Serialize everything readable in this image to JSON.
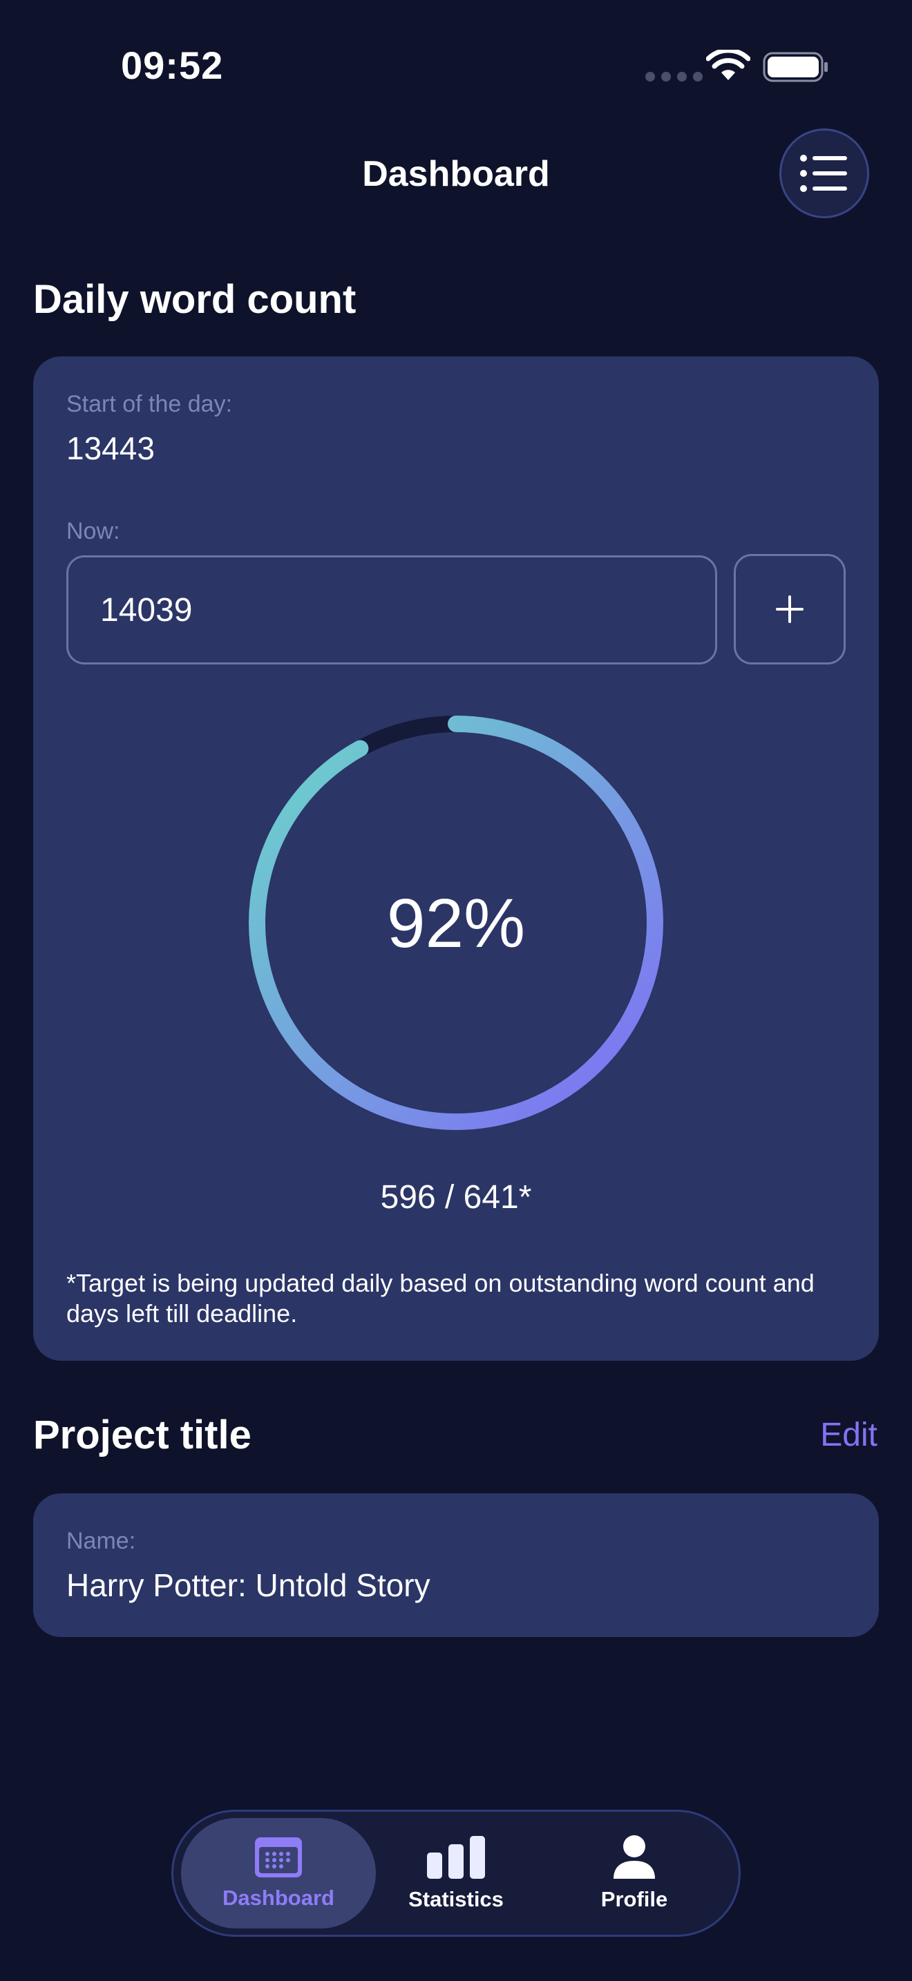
{
  "status_bar": {
    "time": "09:52"
  },
  "header": {
    "title": "Dashboard",
    "menu_icon": "list-icon"
  },
  "daily_word_count": {
    "section_title": "Daily word count",
    "start_label": "Start of the day:",
    "start_value": "13443",
    "now_label": "Now:",
    "now_value": "14039",
    "add_icon": "plus-icon",
    "progress_percent_text": "92%",
    "progress_fraction": 0.92,
    "progress_count": "596 / 641*",
    "target_note": "*Target is being updated daily based on outstanding word count and days left till deadline."
  },
  "project": {
    "section_title": "Project title",
    "edit_label": "Edit",
    "name_label": "Name:",
    "name_value": "Harry Potter: Untold Story"
  },
  "tab_bar": {
    "tabs": [
      {
        "label": "Dashboard",
        "icon": "calendar-icon",
        "active": true
      },
      {
        "label": "Statistics",
        "icon": "bar-chart-icon",
        "active": false
      },
      {
        "label": "Profile",
        "icon": "person-icon",
        "active": false
      }
    ]
  },
  "colors": {
    "background": "#0e132b",
    "card": "#2b3566",
    "accent": "#8572f5",
    "gradient_start": "#7f6cf6",
    "gradient_end": "#6ad6c9"
  }
}
